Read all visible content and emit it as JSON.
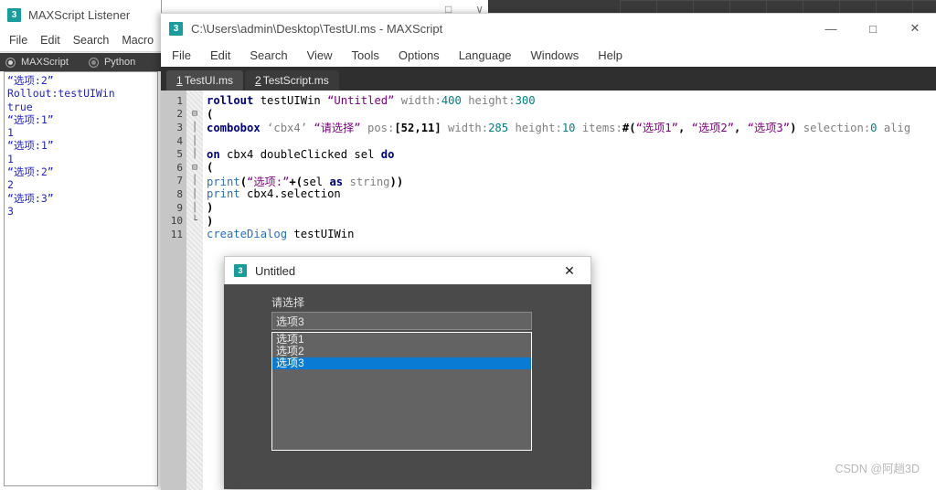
{
  "desktop": {
    "background_color": "#3a3a3a",
    "canvas_color": "#ffffff"
  },
  "listener": {
    "icon_glyph": "3",
    "title": "MAXScript Listener",
    "menu": [
      "File",
      "Edit",
      "Search",
      "Macro"
    ],
    "mode": {
      "maxscript_label": "MAXScript",
      "python_label": "Python",
      "selected": "MAXScript"
    },
    "window_controls": {
      "maximize": "□",
      "close": "∨"
    },
    "output_lines": [
      "“选项:2”",
      "Rollout:testUIWin",
      "true",
      "“选项:1”",
      "1",
      "“选项:1”",
      "1",
      "“选项:2”",
      "2",
      "“选项:3”",
      "3"
    ],
    "output_color": "#2323c8"
  },
  "editor": {
    "icon_glyph": "3",
    "title": "C:\\Users\\admin\\Desktop\\TestUI.ms - MAXScript",
    "menu": [
      "File",
      "Edit",
      "Search",
      "View",
      "Tools",
      "Options",
      "Language",
      "Windows",
      "Help"
    ],
    "window_controls": {
      "minimize": "—",
      "maximize": "□",
      "close": "✕"
    },
    "tabs": [
      {
        "index": "1",
        "label": "TestUI.ms",
        "active": true
      },
      {
        "index": "2",
        "label": "TestScript.ms",
        "active": false
      }
    ],
    "line_numbers": [
      "1",
      "2",
      "3",
      "4",
      "5",
      "6",
      "7",
      "8",
      "9",
      "10",
      "11"
    ],
    "fold_markers": {
      "2": "⊟",
      "6": "⊟"
    },
    "code_lines": [
      [
        {
          "t": "  ",
          "c": "id"
        },
        {
          "t": "rollout",
          "c": "kw"
        },
        {
          "t": " testUIWin ",
          "c": "id"
        },
        {
          "t": "“Untitled”",
          "c": "str"
        },
        {
          "t": " width:",
          "c": "prm"
        },
        {
          "t": "400",
          "c": "num2"
        },
        {
          "t": " height:",
          "c": "prm"
        },
        {
          "t": "300",
          "c": "num2"
        }
      ],
      [
        {
          "t": "  (",
          "c": "punct"
        }
      ],
      [
        {
          "t": "      ",
          "c": "id"
        },
        {
          "t": "combobox",
          "c": "kw"
        },
        {
          "t": " ‘cbx4’ ",
          "c": "prm"
        },
        {
          "t": "“请选择”",
          "c": "str"
        },
        {
          "t": " pos:",
          "c": "prm"
        },
        {
          "t": "[52,11]",
          "c": "punct"
        },
        {
          "t": " width:",
          "c": "prm"
        },
        {
          "t": "285",
          "c": "num2"
        },
        {
          "t": " height:",
          "c": "prm"
        },
        {
          "t": "10",
          "c": "num2"
        },
        {
          "t": " items:",
          "c": "prm"
        },
        {
          "t": "#(",
          "c": "punct"
        },
        {
          "t": "“选项1”",
          "c": "str"
        },
        {
          "t": ",",
          "c": "punct"
        },
        {
          "t": " ",
          "c": "id"
        },
        {
          "t": "“选项2”",
          "c": "str"
        },
        {
          "t": ",",
          "c": "punct"
        },
        {
          "t": " ",
          "c": "id"
        },
        {
          "t": "“选项3”",
          "c": "str"
        },
        {
          "t": ")",
          "c": "punct"
        },
        {
          "t": " selection:",
          "c": "prm"
        },
        {
          "t": "0",
          "c": "num2"
        },
        {
          "t": " alig",
          "c": "prm"
        }
      ],
      [],
      [
        {
          "t": "      ",
          "c": "id"
        },
        {
          "t": "on",
          "c": "kw"
        },
        {
          "t": " cbx4 doubleClicked sel ",
          "c": "id"
        },
        {
          "t": "do",
          "c": "kw"
        }
      ],
      [
        {
          "t": "      (",
          "c": "punct"
        }
      ],
      [
        {
          "t": "        ",
          "c": "id"
        },
        {
          "t": "print",
          "c": "fn"
        },
        {
          "t": "(",
          "c": "punct"
        },
        {
          "t": "“选项:”",
          "c": "str"
        },
        {
          "t": "+(",
          "c": "punct"
        },
        {
          "t": "sel ",
          "c": "id"
        },
        {
          "t": "as",
          "c": "kw"
        },
        {
          "t": " ",
          "c": "id"
        },
        {
          "t": "string",
          "c": "prm"
        },
        {
          "t": "))",
          "c": "punct"
        }
      ],
      [
        {
          "t": "        ",
          "c": "id"
        },
        {
          "t": "print",
          "c": "fn"
        },
        {
          "t": " cbx4.selection",
          "c": "id"
        }
      ],
      [
        {
          "t": "      )",
          "c": "punct"
        }
      ],
      [
        {
          "t": "  )",
          "c": "punct"
        }
      ],
      [
        {
          "t": "  createDialog",
          "c": "fn"
        },
        {
          "t": " testUIWin",
          "c": "id"
        }
      ]
    ]
  },
  "dialog": {
    "icon_glyph": "3",
    "title": "Untitled",
    "close_glyph": "✕",
    "combobox": {
      "label": "请选择",
      "selected_value": "选项3",
      "items": [
        "选项1",
        "选项2",
        "选项3"
      ],
      "selected_index": 2,
      "highlight_color": "#0a7bd4"
    }
  },
  "watermark": {
    "text": "CSDN @阿趟3D"
  }
}
